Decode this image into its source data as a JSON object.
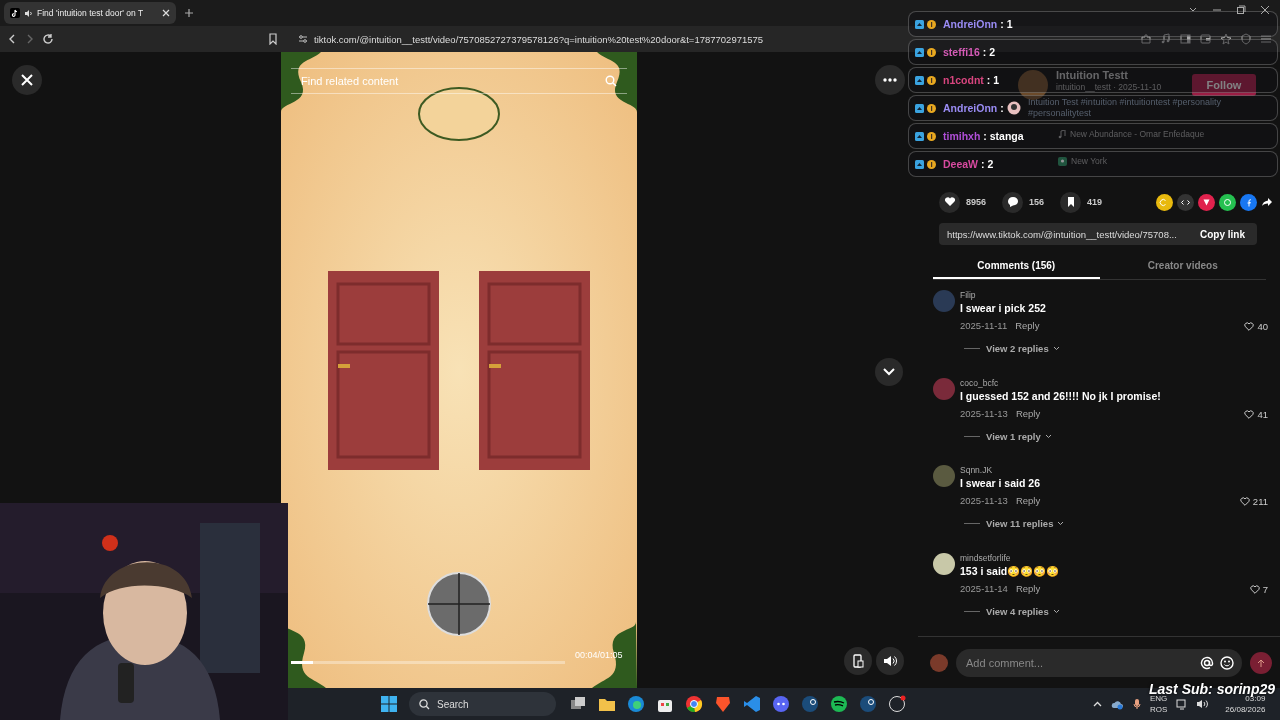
{
  "browser": {
    "tab_title": "Find 'intuition test door' on T",
    "url": "tiktok.com/@intuition__testt/video/7570852727379578126?q=intuition%20test%20door&t=1787702971575"
  },
  "video": {
    "search_placeholder": "Find related content",
    "level": 0.08,
    "time": "00:04/01:05"
  },
  "profile": {
    "name": "Intuition Testt",
    "handle_date": "intuition__testt · 2025-11-10",
    "follow": "Follow",
    "description": "Intuition Test #intuition #intuitiontest #personality #personalitytest",
    "music": "New Abundance - Omar Enfedaque",
    "location": "New York"
  },
  "stats": {
    "likes": "8956",
    "comments": "156",
    "saves": "419"
  },
  "share": {
    "link": "https://www.tiktok.com/@intuition__testt/video/75708...",
    "copy": "Copy link"
  },
  "tabs": [
    {
      "label": "Comments (156)",
      "selected": true
    },
    {
      "label": "Creator videos",
      "selected": false
    }
  ],
  "comments": [
    {
      "user": "Filip",
      "text": "I swear i pick 252",
      "date": "2025-11-11",
      "reply": "Reply",
      "likes": "40",
      "replies": "View 2 replies"
    },
    {
      "user": "coco_bcfc",
      "text": "I guessed 152 and 26!!!! No jk I promise!",
      "date": "2025-11-13",
      "reply": "Reply",
      "likes": "41",
      "replies": "View 1 reply"
    },
    {
      "user": "Sqnn.JK",
      "text": "I swear i said 26",
      "date": "2025-11-13",
      "reply": "Reply",
      "likes": "211",
      "replies": "View 11 replies"
    },
    {
      "user": "mindsetforlife",
      "text": "153 i said😳😳😳😳",
      "date": "2025-11-14",
      "reply": "Reply",
      "likes": "7",
      "replies": "View 4 replies"
    }
  ],
  "comment_input": {
    "placeholder": "Add comment..."
  },
  "chat": [
    {
      "user": "AndreiOnn",
      "color": "#9a8cf5",
      "kind": "text",
      "message": ": 1"
    },
    {
      "user": "steffi16",
      "color": "#d45ab6",
      "kind": "text",
      "message": ": 2"
    },
    {
      "user": "n1codnt",
      "color": "#d8457f",
      "kind": "text",
      "message": ": 1"
    },
    {
      "user": "AndreiOnn",
      "color": "#9a8cf5",
      "kind": "emote",
      "message": ":"
    },
    {
      "user": "timihxh",
      "color": "#b04fd8",
      "kind": "text",
      "message": ": stanga"
    },
    {
      "user": "DeeaW",
      "color": "#d84aa0",
      "kind": "text",
      "message": ": 2"
    }
  ],
  "last_sub": "Last Sub: sorinp29",
  "taskbar": {
    "search": "Search",
    "lang": "ENG",
    "layout": "ROS",
    "time": "03:09",
    "date": "26/08/2026"
  }
}
